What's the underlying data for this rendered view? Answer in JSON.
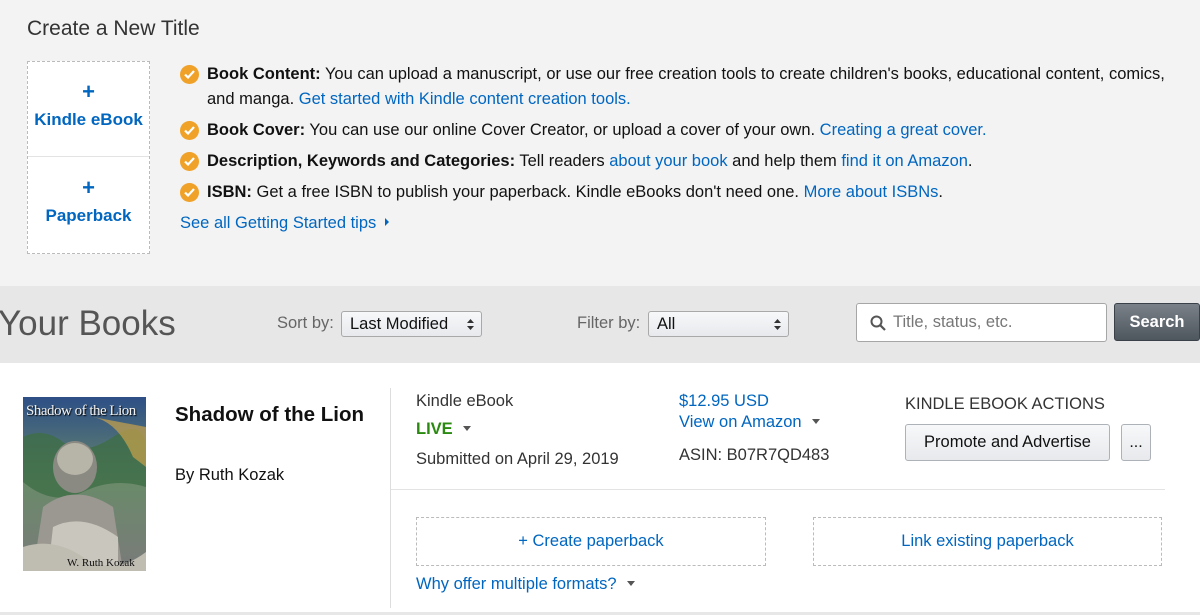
{
  "create_section": {
    "title": "Create a New Title",
    "formats": [
      {
        "plus": "+",
        "label": "Kindle eBook"
      },
      {
        "plus": "+",
        "label": "Paperback"
      }
    ],
    "tips": [
      {
        "bold": "Book Content:",
        "text": " You can upload a manuscript, or use our free creation tools to create children's books, educational content, comics, and manga. ",
        "link": "Get started with Kindle content creation tools."
      },
      {
        "bold": "Book Cover:",
        "text": " You can use our online Cover Creator, or upload a cover of your own. ",
        "link": "Creating a great cover."
      },
      {
        "bold": "Description, Keywords and Categories:",
        "text1": " Tell readers ",
        "link1": "about your book",
        "text2": " and help them ",
        "link2": "find it on Amazon",
        "text3": "."
      },
      {
        "bold": "ISBN:",
        "text": " Get a free ISBN to publish your paperback. Kindle eBooks don't need one. ",
        "link": "More about ISBNs",
        "text_end": "."
      }
    ],
    "see_all": "See all Getting Started tips",
    "check_color": "#f0a128"
  },
  "books_bar": {
    "title": "Your Books",
    "sort_label": "Sort by:",
    "sort_value": "Last Modified",
    "filter_label": "Filter by:",
    "filter_value": "All",
    "search_placeholder": "Title, status, etc.",
    "search_button": "Search"
  },
  "book": {
    "cover_title": "Shadow of the Lion",
    "cover_author": "W. Ruth Kozak",
    "title": "Shadow of the Lion",
    "author": "By Ruth Kozak",
    "format_type": "Kindle eBook",
    "status": "LIVE",
    "status_color": "#2a8a10",
    "submitted": "Submitted on April 29, 2019",
    "price": "$12.95 USD",
    "view_on_amazon": "View on Amazon",
    "asin": "ASIN: B07R7QD483",
    "actions_label": "KINDLE EBOOK ACTIONS",
    "promote_button": "Promote and Advertise",
    "more_button": "...",
    "create_paperback": "+ Create paperback",
    "link_paperback": "Link existing paperback",
    "why_formats": "Why offer multiple formats?"
  },
  "colors": {
    "link": "#0066c0",
    "page_bg": "#f3f3f3",
    "bar_bg": "#e7e7e7"
  }
}
